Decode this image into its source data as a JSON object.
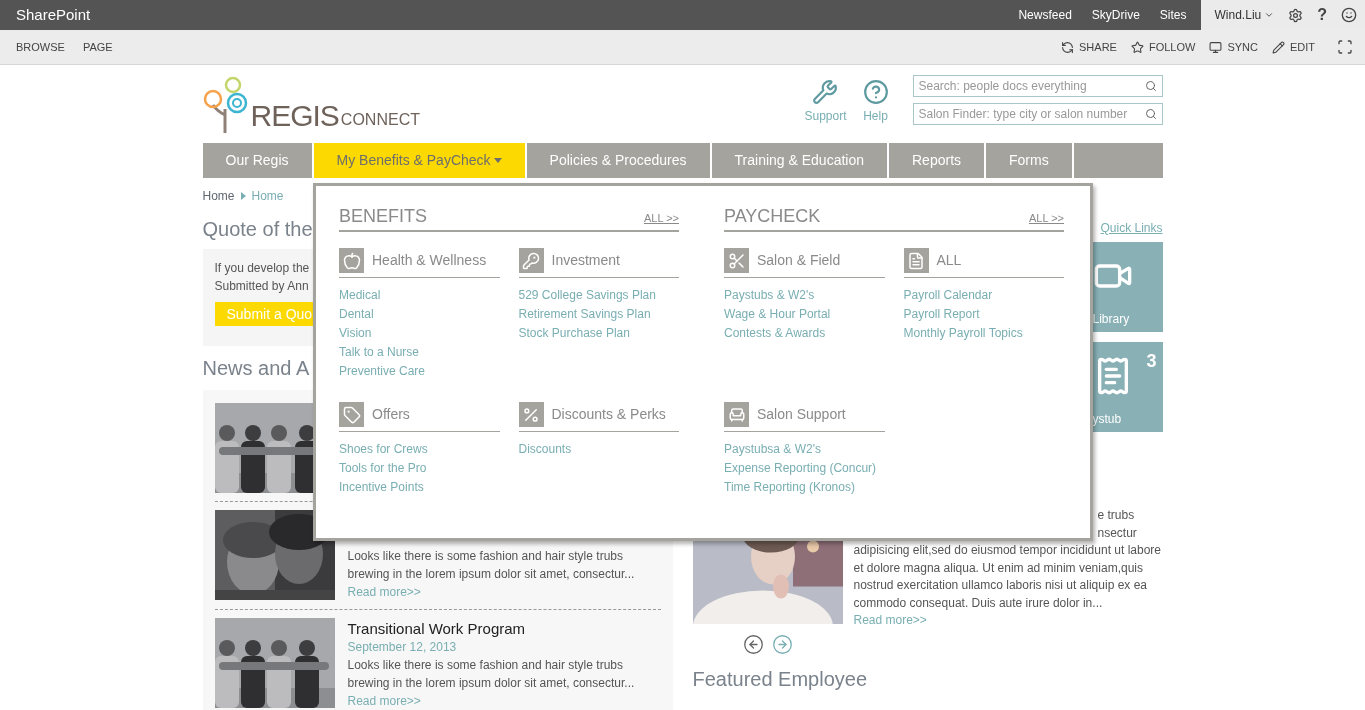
{
  "top_bar": {
    "brand": "SharePoint",
    "links": [
      "Newsfeed",
      "SkyDrive",
      "Sites"
    ],
    "user": "Wind.Liu",
    "help_glyph": "?"
  },
  "ribbon": {
    "tabs": [
      "BROWSE",
      "PAGE"
    ],
    "actions": [
      "SHARE",
      "FOLLOW",
      "SYNC",
      "EDIT"
    ]
  },
  "header": {
    "logo": {
      "main": "REGIS",
      "sub": "CONNECT"
    },
    "utilities": [
      "Support",
      "Help"
    ],
    "search_fields": [
      {
        "placeholder": "Search: people docs everything"
      },
      {
        "placeholder": "Salon Finder: type city or salon number"
      }
    ]
  },
  "nav": [
    {
      "label": "Our Regis",
      "selected": false,
      "dropdown": false
    },
    {
      "label": "My Benefits & PayCheck",
      "selected": true,
      "dropdown": true
    },
    {
      "label": "Policies & Procedures",
      "selected": false,
      "dropdown": false
    },
    {
      "label": "Training & Education",
      "selected": false,
      "dropdown": false
    },
    {
      "label": "Reports",
      "selected": false,
      "dropdown": false
    },
    {
      "label": "Forms",
      "selected": false,
      "dropdown": false
    }
  ],
  "breadcrumb": [
    "Home",
    "Home"
  ],
  "quote": {
    "title": "Quote of the",
    "lines": [
      "If you develop the",
      "Submitted by Ann"
    ],
    "button": "Submit a Quo"
  },
  "news": {
    "title": "News and A",
    "items": [
      {
        "kind": "picture"
      },
      {
        "kind": "picture",
        "body": [
          "Looks like there is some fashion and hair style trubs",
          "brewing in the lorem ipsum dolor sit amet, consectur..."
        ],
        "link": "Read more>>"
      },
      {
        "kind": "picture",
        "title": "Transitional Work Program",
        "date": "September 12, 2013",
        "body": [
          "Looks like there is some fashion and hair style trubs",
          "brewing in the lorem ipsum dolor sit amet, consectur..."
        ],
        "link": "Read more>>"
      }
    ]
  },
  "quick_links": {
    "link": "Quick Links",
    "tiles": [
      {
        "label": "Library"
      },
      {
        "label": "ystub",
        "badge": "3"
      }
    ]
  },
  "featured": {
    "partial_lines": [
      "e trubs",
      "nsectur"
    ],
    "body": [
      "adipisicing elit,sed do eiusmod tempor incididunt ut labore",
      "et dolore magna aliqua. Ut enim ad minim veniam,quis",
      "nostrud exercitation ullamco laboris nisi ut aliquip ex ea",
      "commodo consequat. Duis aute irure dolor in..."
    ],
    "link": "Read more>>"
  },
  "featured_employee": {
    "title": "Featured Employee"
  },
  "dropdown": {
    "sections": [
      {
        "title": "BENEFITS",
        "all_link": "ALL >>",
        "groups": [
          {
            "label": "Health & Wellness",
            "links": [
              "Medical",
              "Dental",
              "Vision",
              "Talk to a Nurse",
              "Preventive Care"
            ]
          },
          {
            "label": "Investment",
            "links": [
              "529 College Savings Plan",
              "Retirement Savings Plan",
              "Stock Purchase Plan"
            ]
          },
          {
            "label": "Offers",
            "links": [
              "Shoes for Crews",
              "Tools for the Pro",
              "Incentive Points"
            ]
          },
          {
            "label": "Discounts & Perks",
            "links": [
              "Discounts"
            ]
          }
        ]
      },
      {
        "title": "PAYCHECK",
        "all_link": "ALL >>",
        "groups": [
          {
            "label": "Salon & Field",
            "links": [
              "Paystubs & W2's",
              "Wage & Hour Portal",
              "Contests & Awards"
            ]
          },
          {
            "label": "ALL",
            "links": [
              "Payroll Calendar",
              "Payroll Report",
              "Monthly Payroll Topics"
            ]
          },
          {
            "label": "Salon Support",
            "links": [
              "Paystubsa & W2's",
              "Expense Reporting (Concur)",
              "Time Reporting (Kronos)"
            ]
          }
        ]
      }
    ]
  }
}
